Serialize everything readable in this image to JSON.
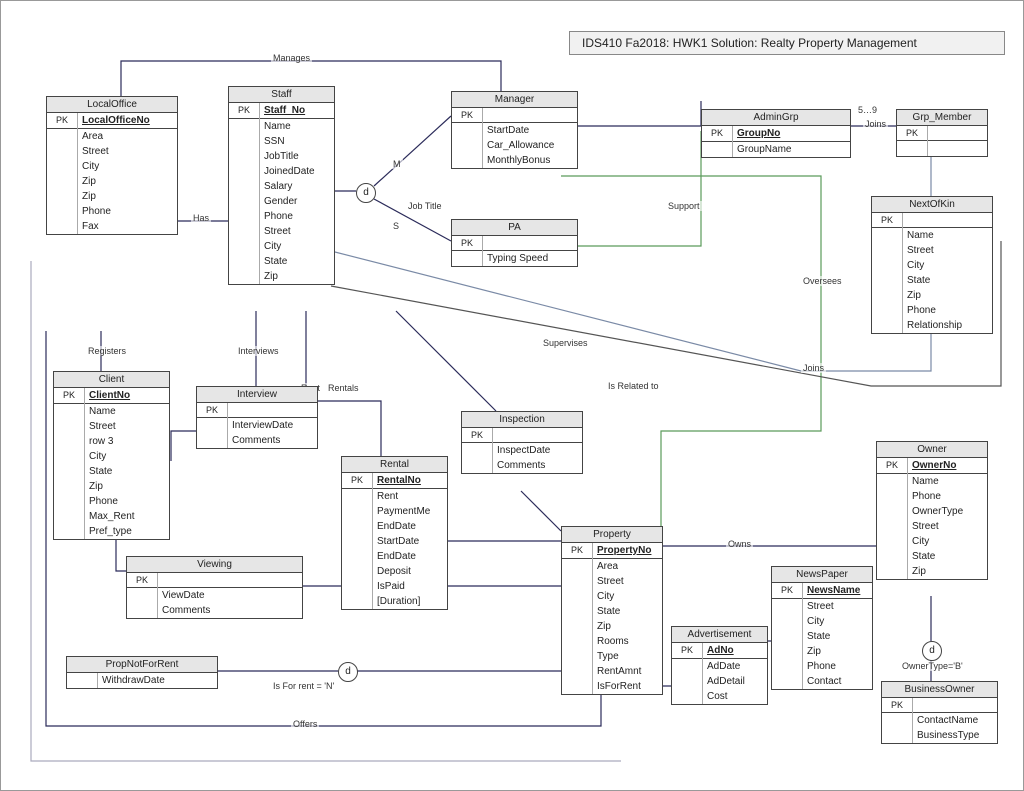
{
  "title": "IDS410 Fa2018: HWK1 Solution: Realty Property Management",
  "labels": {
    "manages": "Manages",
    "has": "Has",
    "registers": "Registers",
    "interviews": "Interviews",
    "rent": "Rent",
    "rentals": "Rentals",
    "supervises": "Supervises",
    "support": "Support",
    "oversees": "Oversees",
    "joins_rel": "Joins",
    "joins2": "Joins",
    "card59": "5…9",
    "jobtitle": "Job Title",
    "m": "M",
    "s": "S",
    "isrelated": "Is Related to",
    "owns": "Owns",
    "ownertype_b": "OwnerType='B'",
    "isforrent_n": "Is For rent = 'N'",
    "offers": "Offers"
  },
  "circles": {
    "d1": "d",
    "d2": "d",
    "d3": "d"
  },
  "entities": {
    "localoffice": {
      "name": "LocalOffice",
      "pk": "LocalOfficeNo",
      "attrs": [
        "Area",
        "Street",
        "City",
        "Zip",
        "Zip",
        "Phone",
        "Fax"
      ]
    },
    "staff": {
      "name": "Staff",
      "pk": "Staff_No",
      "attrs": [
        "Name",
        "SSN",
        "JobTitle",
        "JoinedDate",
        "Salary",
        "Gender",
        "Phone",
        "Street",
        "City",
        "State",
        "Zip"
      ]
    },
    "manager": {
      "name": "Manager",
      "pk": "",
      "attrs": [
        "StartDate",
        "Car_Allowance",
        "MonthlyBonus"
      ]
    },
    "pa": {
      "name": "PA",
      "pk": "",
      "attrs": [
        "Typing Speed"
      ]
    },
    "admingrp": {
      "name": "AdminGrp",
      "pk": "GroupNo",
      "attrs": [
        "GroupName"
      ]
    },
    "grpmember": {
      "name": "Grp_Member",
      "pk": "",
      "attrs": []
    },
    "nextofkin": {
      "name": "NextOfKin",
      "pk": "",
      "attrs": [
        "Name",
        "Street",
        "City",
        "State",
        "Zip",
        "Phone",
        "Relationship"
      ]
    },
    "client": {
      "name": "Client",
      "pk": "ClientNo",
      "attrs": [
        "Name",
        "Street",
        "row 3",
        "City",
        "State",
        "Zip",
        "Phone",
        "Max_Rent",
        "Pref_type"
      ]
    },
    "interview": {
      "name": "Interview",
      "pk": "",
      "attrs": [
        "InterviewDate",
        "Comments"
      ]
    },
    "inspection": {
      "name": "Inspection",
      "pk": "",
      "attrs": [
        "InspectDate",
        "Comments"
      ]
    },
    "rental": {
      "name": "Rental",
      "pk": "RentalNo",
      "attrs": [
        "Rent",
        "PaymentMe",
        "EndDate",
        "StartDate",
        "EndDate",
        "Deposit",
        "IsPaid",
        "[Duration]"
      ]
    },
    "property": {
      "name": "Property",
      "pk": "PropertyNo",
      "attrs": [
        "Area",
        "Street",
        "City",
        "State",
        "Zip",
        "Rooms",
        "Type",
        "RentAmnt",
        "IsForRent"
      ]
    },
    "viewing": {
      "name": "Viewing",
      "pk": "",
      "attrs": [
        "ViewDate",
        "Comments"
      ]
    },
    "propnotforrent": {
      "name": "PropNotForRent",
      "pk": "",
      "attrs": [
        "WithdrawDate"
      ]
    },
    "advertisement": {
      "name": "Advertisement",
      "pk": "AdNo",
      "attrs": [
        "AdDate",
        "AdDetail",
        "Cost"
      ]
    },
    "newspaper": {
      "name": "NewsPaper",
      "pk": "NewsName",
      "attrs": [
        "Street",
        "City",
        "State",
        "Zip",
        "Phone",
        "Contact"
      ]
    },
    "owner": {
      "name": "Owner",
      "pk": "OwnerNo",
      "attrs": [
        "Name",
        "Phone",
        "OwnerType",
        "Street",
        "City",
        "State",
        "Zip"
      ]
    },
    "businessowner": {
      "name": "BusinessOwner",
      "pk": "",
      "attrs": [
        "ContactName",
        "BusinessType"
      ]
    }
  }
}
